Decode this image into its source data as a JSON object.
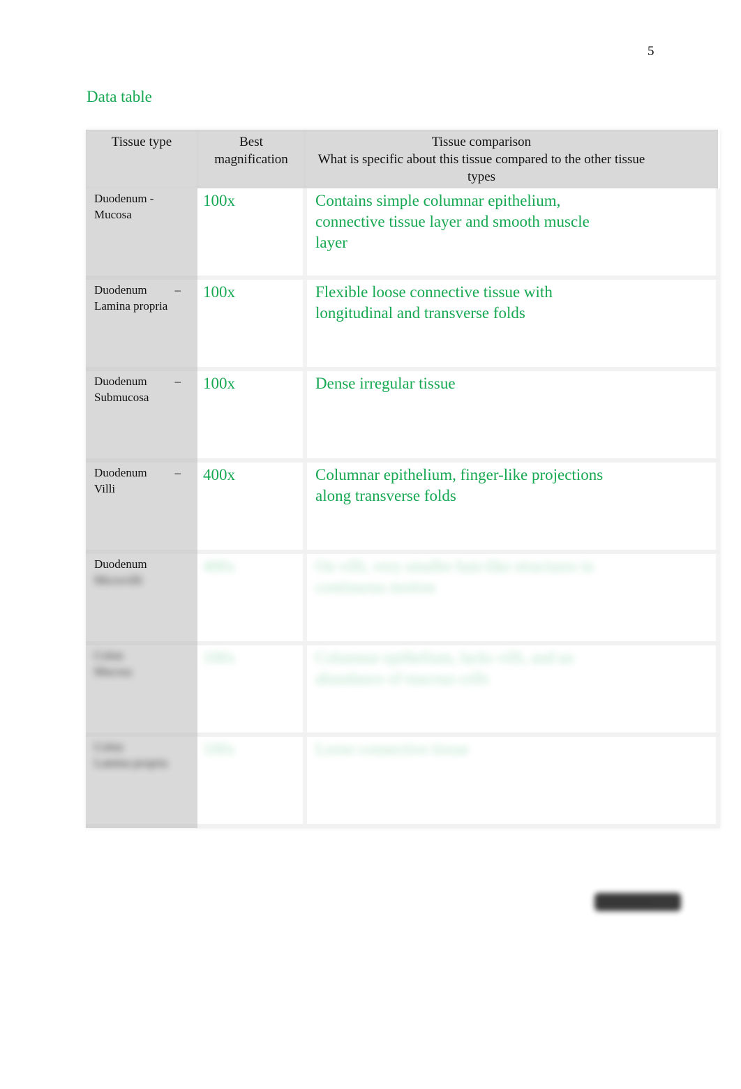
{
  "page": {
    "page_number": "5",
    "section_title": "Data table"
  },
  "table": {
    "headers": {
      "tissue_type": "Tissue type",
      "best_magnification": "Best magnification",
      "tissue_comparison_title": "Tissue comparison",
      "tissue_comparison_subtitle": "What is specific about this tissue compared to the other tissue types"
    },
    "rows": [
      {
        "tissue_line1": "Duodenum -",
        "tissue_line1_suffix": "",
        "tissue_rest": "Mucosa",
        "magnification": "100x",
        "comparison": "Contains simple columnar epithelium, connective tissue layer and smooth muscle layer",
        "obscured": false
      },
      {
        "tissue_line1": "Duodenum",
        "tissue_line1_suffix": "–",
        "tissue_rest": "Lamina propria",
        "magnification": "100x",
        "comparison": "Flexible loose connective tissue with longitudinal and transverse folds",
        "obscured": false
      },
      {
        "tissue_line1": "Duodenum",
        "tissue_line1_suffix": "–",
        "tissue_rest": "Submucosa",
        "magnification": "100x",
        "comparison": "Dense irregular tissue",
        "obscured": false
      },
      {
        "tissue_line1": "Duodenum",
        "tissue_line1_suffix": "–",
        "tissue_rest": "Villi",
        "magnification": "400x",
        "comparison": "Columnar epithelium, finger-like projections along transverse folds",
        "obscured": false
      },
      {
        "tissue_line1": "Duodenum",
        "tissue_line1_suffix": "",
        "tissue_rest": "Microvilli",
        "magnification": "400x",
        "comparison": "On villi, very smaller hair-like structures in continuous motion",
        "obscured": true
      },
      {
        "tissue_line1": "Colon",
        "tissue_line1_suffix": "",
        "tissue_rest": "Mucosa",
        "magnification": "100x",
        "comparison": "Columnar epithelium, lacks villi, and an abundance of mucous cells",
        "obscured": true
      },
      {
        "tissue_line1": "Colon",
        "tissue_line1_suffix": "",
        "tissue_rest": "Lamina propria",
        "magnification": "100x",
        "comparison": "Loose connective tissue",
        "obscured": true
      }
    ]
  },
  "obscured_badge": {
    "label": "········"
  },
  "colors": {
    "accent_green": "#17a852",
    "header_gray": "#d9d9d9",
    "text": "#111111"
  }
}
